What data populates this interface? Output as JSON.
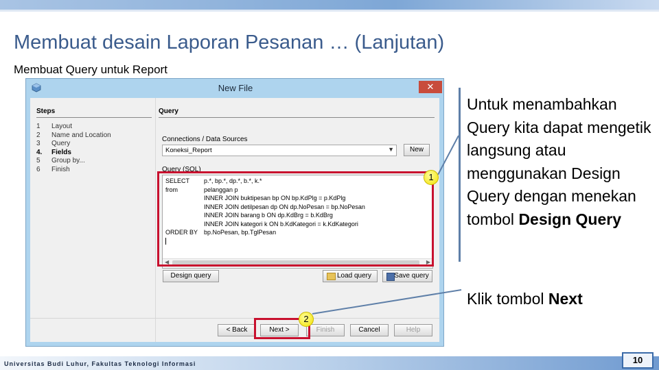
{
  "slide": {
    "title": "Membuat desain Laporan Pesanan … (Lanjutan)",
    "subtitle": "Membuat Query untuk Report",
    "footer": "Universitas Budi Luhur, Fakultas Teknologi Informasi",
    "page_number": "10"
  },
  "dialog": {
    "title": "New File",
    "close_glyph": "✕",
    "steps_heading": "Steps",
    "steps": [
      {
        "num": "1",
        "label": "Layout"
      },
      {
        "num": "2",
        "label": "Name and Location"
      },
      {
        "num": "3",
        "label": "Query"
      },
      {
        "num": "4.",
        "label": "Fields"
      },
      {
        "num": "5",
        "label": "Group by..."
      },
      {
        "num": "6",
        "label": "Finish"
      }
    ],
    "panel_heading": "Query",
    "connections_label": "Connections / Data Sources",
    "connection_value": "Koneksi_Report",
    "new_button": "New",
    "query_label": "Query (SQL)",
    "sql": [
      {
        "kw": "SELECT",
        "text": "p.*, bp.*, dp.*, b.*, k.*"
      },
      {
        "kw": "from",
        "text": "pelanggan p"
      },
      {
        "kw": "",
        "text": "INNER JOIN buktipesan bp ON bp.KdPlg = p.KdPlg"
      },
      {
        "kw": "",
        "text": "INNER JOIN detilpesan dp ON dp.NoPesan = bp.NoPesan"
      },
      {
        "kw": "",
        "text": "INNER JOIN barang b ON dp.KdBrg = b.KdBrg"
      },
      {
        "kw": "",
        "text": "INNER JOIN kategori k ON b.KdKategori = k.KdKategori"
      },
      {
        "kw": "ORDER BY",
        "text": "bp.NoPesan, bp.TglPesan"
      }
    ],
    "design_query_button": "Design query",
    "load_query_button": "Load query",
    "save_query_button": "Save query",
    "back_button": "< Back",
    "next_button": "Next >",
    "finish_button": "Finish",
    "cancel_button": "Cancel",
    "help_button": "Help"
  },
  "annotations": {
    "marker_1": "1",
    "marker_2": "2",
    "desc_main": "Untuk menambahkan Query kita dapat mengetik langsung atau menggunakan Design Query dengan menekan tombol",
    "desc_main_bold": "Design Query",
    "desc_next_prefix": "Klik tombol",
    "desc_next_bold": "Next"
  },
  "colors": {
    "title": "#3a5b8c",
    "highlight_red": "#c8102e",
    "marker_yellow": "#f2e000",
    "dialog_frame": "#aed4ee"
  }
}
